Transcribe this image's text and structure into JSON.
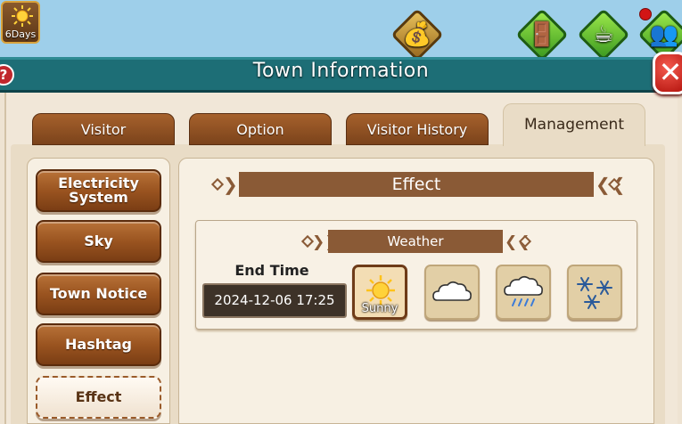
{
  "hud": {
    "days_label": "6Days"
  },
  "window": {
    "title": "Town Information",
    "help_symbol": "?",
    "close_symbol": "✕"
  },
  "tabs": [
    {
      "label": "Visitor",
      "active": false
    },
    {
      "label": "Option",
      "active": false
    },
    {
      "label": "Visitor History",
      "active": false
    },
    {
      "label": "Management",
      "active": true
    }
  ],
  "menu": [
    {
      "label": "Electricity System",
      "active": false
    },
    {
      "label": "Sky",
      "active": false
    },
    {
      "label": "Town Notice",
      "active": false
    },
    {
      "label": "Hashtag",
      "active": false
    },
    {
      "label": "Effect",
      "active": true
    }
  ],
  "content": {
    "section_title": "Effect",
    "weather_title": "Weather",
    "end_time_label": "End Time",
    "end_time_value": "2024-12-06 17:25",
    "weather_options": [
      {
        "icon": "sun-icon",
        "label": "Sunny",
        "selected": true
      },
      {
        "icon": "cloud-icon",
        "label": "",
        "selected": false
      },
      {
        "icon": "rain-cloud-icon",
        "label": "",
        "selected": false
      },
      {
        "icon": "snowflakes-icon",
        "label": "",
        "selected": false
      }
    ]
  },
  "colors": {
    "titlebar": "#1d6e76",
    "tab_brown": "#9a5420",
    "close_red": "#d21515"
  }
}
